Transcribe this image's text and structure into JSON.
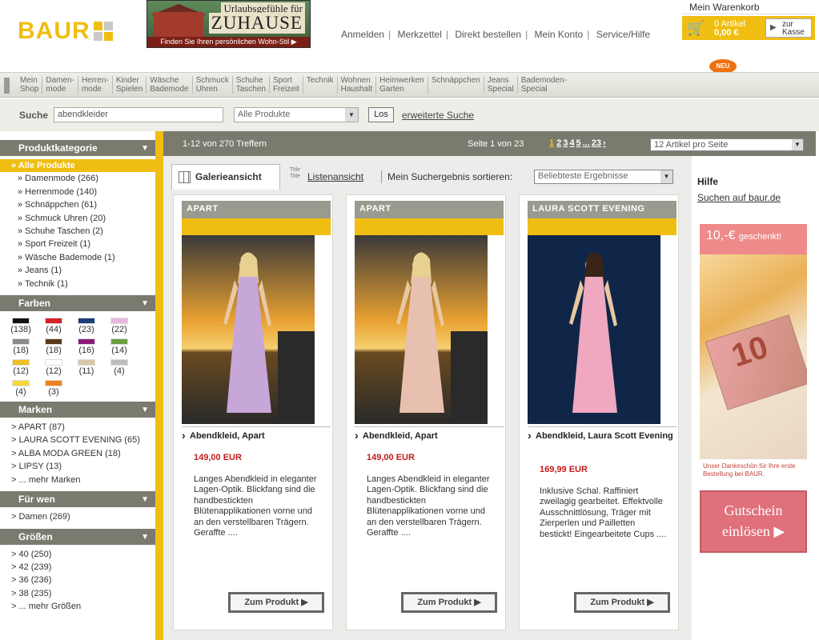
{
  "header": {
    "logo": "BAUR",
    "promo": {
      "line1": "Urlaubsgefühle für",
      "line2": "ZUHAUSE",
      "line3": "Finden Sie Ihren persönlichen Wohn-Stil ▶"
    },
    "links": [
      "Anmelden",
      "Merkzettel",
      "Direkt bestellen",
      "Mein Konto",
      "Service/Hilfe"
    ],
    "cart": {
      "title": "Mein Warenkorb",
      "articles": "0 Artikel",
      "sum": "0,00 €",
      "checkout": "zur Kasse"
    }
  },
  "nav": {
    "items": [
      "Mein\nShop",
      "Damen-\nmode",
      "Herren-\nmode",
      "Kinder\nSpielen",
      "Wäsche\nBademode",
      "Schmuck\nUhren",
      "Schuhe\nTaschen",
      "Sport\nFreizeit",
      "Technik",
      "Wohnen\nHaushalt",
      "Heimwerken\nGarten",
      "Schnäppchen",
      "Jeans\nSpecial",
      "Bademoden-\nSpecial"
    ],
    "badge": "NEU"
  },
  "search": {
    "label": "Suche",
    "value": "abendkleider",
    "category": "Alle Produkte",
    "go": "Los",
    "advanced": "erweiterte Suche"
  },
  "sidebar": {
    "category_title": "Produktkategorie",
    "categories": [
      "» Alle Produkte",
      "» Damenmode (266)",
      "» Herrenmode (140)",
      "» Schnäppchen (61)",
      "» Schmuck Uhren (20)",
      "» Schuhe Taschen (2)",
      "» Sport Freizeit (1)",
      "» Wäsche Bademode (1)",
      "» Jeans (1)",
      "» Technik (1)"
    ],
    "colors_title": "Farben",
    "colors": [
      {
        "hex": "#111111",
        "count": "(138)"
      },
      {
        "hex": "#d8202a",
        "count": "(44)"
      },
      {
        "hex": "#1d3d7a",
        "count": "(23)"
      },
      {
        "hex": "#e8b8e0",
        "count": "(22)"
      },
      {
        "hex": "#8a8a8a",
        "count": "(18)"
      },
      {
        "hex": "#5a3a1a",
        "count": "(18)"
      },
      {
        "hex": "#8a1a7a",
        "count": "(16)"
      },
      {
        "hex": "#6aa040",
        "count": "(14)"
      },
      {
        "hex": "#f0c020",
        "count": "(12)"
      },
      {
        "hex": "#ffffff",
        "count": "(12)"
      },
      {
        "hex": "#d8c8a8",
        "count": "(11)"
      },
      {
        "hex": "#bdbdbd",
        "count": "(4)"
      },
      {
        "hex": "#f6d838",
        "count": "(4)"
      },
      {
        "hex": "#f08020",
        "count": "(3)"
      }
    ],
    "brands_title": "Marken",
    "brands": [
      "> APART (87)",
      "> LAURA SCOTT EVENING (65)",
      "> ALBA MODA GREEN (18)",
      "> LIPSY (13)",
      "> ... mehr Marken"
    ],
    "for_title": "Für wen",
    "for": [
      "> Damen (269)"
    ],
    "sizes_title": "Größen",
    "sizes": [
      "> 40 (250)",
      "> 42 (239)",
      "> 36 (236)",
      "> 38 (235)",
      "> ... mehr Größen"
    ]
  },
  "results": {
    "count": "1-12 von 270 Treffern",
    "page": "Seite 1 von 23",
    "pages": [
      "1",
      "2",
      "3",
      "4",
      "5",
      "...",
      "23",
      "›"
    ],
    "per_page": "12 Artikel pro Seite"
  },
  "view": {
    "gallery": "Galerieansicht",
    "list_icon": "Title Title",
    "list": "Listenansicht",
    "sort_label": "Mein Suchergebnis sortieren:",
    "sort_value": "Beliebteste Ergebnisse"
  },
  "products": [
    {
      "brand": "APART",
      "name": "Abendkleid, Apart",
      "price": "149,00 EUR",
      "desc": "Langes Abendkleid in eleganter Lagen-Optik. Blickfang sind die handbestickten Blütenapplikationen vorne und an den verstellbaren Trägern. Geraffte ....",
      "button": "Zum Produkt ▶",
      "dress": "#c7a6d8",
      "bg": "sunset"
    },
    {
      "brand": "APART",
      "name": "Abendkleid, Apart",
      "price": "149,00 EUR",
      "desc": "Langes Abendkleid in eleganter Lagen-Optik. Blickfang sind die handbestickten Blütenapplikationen vorne und an den verstellbaren Trägern. Geraffte ....",
      "button": "Zum Produkt ▶",
      "dress": "#e8c0b0",
      "bg": "sunset"
    },
    {
      "brand": "LAURA SCOTT EVENING",
      "name": "Abendkleid, Laura Scott Evening",
      "price": "169,99 EUR",
      "desc": "Inklusive Schal. Raffiniert zweilagig gearbeitet. Effektvolle Ausschnittlösung, Träger mit Zierperlen und Pailletten bestickt! Eingearbeitete Cups ....",
      "button": "Zum Produkt ▶",
      "dress": "#efa8c0",
      "bg": "navy"
    }
  ],
  "help": {
    "title": "Hilfe",
    "link": "Suchen auf baur.de"
  },
  "ad": {
    "amount": "10,-€",
    "amount_suffix": "geschenkt!",
    "note": "10",
    "text": "Unser Dankeschön für Ihre erste Bestellung bei BAUR.",
    "button": "Gutschein einlösen ▶"
  }
}
